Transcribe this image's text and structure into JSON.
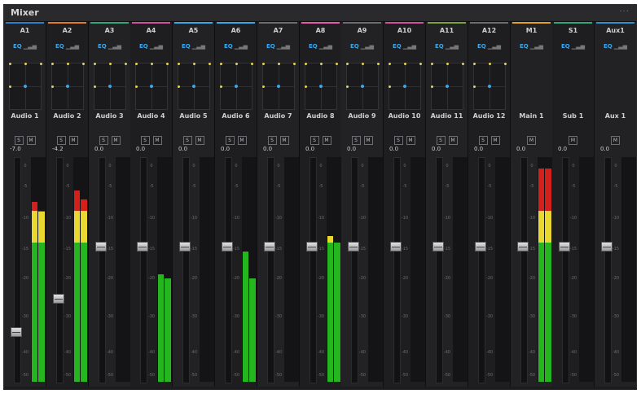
{
  "window": {
    "title": "Mixer",
    "menu": "···"
  },
  "colors": {
    "eq": "#3aa6e8",
    "green": "#24b51f",
    "yellow": "#e8d830",
    "red": "#d4201b"
  },
  "strips": [
    {
      "track": "A1",
      "name": "Audio 1",
      "db": "-7.0",
      "color": "#2b7fd0",
      "solo": true,
      "pan": true,
      "level": 0.78,
      "meters": [
        0.8,
        0.76
      ]
    },
    {
      "track": "A2",
      "name": "Audio 2",
      "db": "-4.2",
      "color": "#e07a2a",
      "solo": true,
      "pan": true,
      "level": 0.63,
      "meters": [
        0.85,
        0.81
      ]
    },
    {
      "track": "A3",
      "name": "Audio 3",
      "db": "0.0",
      "color": "#2fa67a",
      "solo": true,
      "pan": true,
      "level": 0.4,
      "meters": [
        0,
        0
      ]
    },
    {
      "track": "A4",
      "name": "Audio 4",
      "db": "0.0",
      "color": "#d14fa0",
      "solo": true,
      "pan": true,
      "level": 0.4,
      "meters": [
        0.48,
        0.46
      ]
    },
    {
      "track": "A5",
      "name": "Audio 5",
      "db": "0.0",
      "color": "#3aa6e8",
      "solo": true,
      "pan": true,
      "level": 0.4,
      "meters": [
        0,
        0
      ]
    },
    {
      "track": "A6",
      "name": "Audio 6",
      "db": "0.0",
      "color": "#3aa6e8",
      "solo": true,
      "pan": true,
      "level": 0.4,
      "meters": [
        0.58,
        0.46
      ]
    },
    {
      "track": "A7",
      "name": "Audio 7",
      "db": "0.0",
      "color": "#6b6b70",
      "solo": true,
      "pan": true,
      "level": 0.4,
      "meters": [
        0,
        0
      ]
    },
    {
      "track": "A8",
      "name": "Audio 8",
      "db": "0.0",
      "color": "#e35aa8",
      "solo": true,
      "pan": true,
      "level": 0.4,
      "meters": [
        0.65,
        0.62
      ]
    },
    {
      "track": "A9",
      "name": "Audio 9",
      "db": "0.0",
      "color": "#6b6b70",
      "solo": true,
      "pan": true,
      "level": 0.4,
      "meters": [
        0,
        0
      ]
    },
    {
      "track": "A10",
      "name": "Audio 10",
      "db": "0.0",
      "color": "#d14fa0",
      "solo": true,
      "pan": true,
      "level": 0.4,
      "meters": [
        0,
        0
      ]
    },
    {
      "track": "A11",
      "name": "Audio 11",
      "db": "0.0",
      "color": "#7aa33a",
      "solo": true,
      "pan": true,
      "level": 0.4,
      "meters": [
        0,
        0
      ]
    },
    {
      "track": "A12",
      "name": "Audio 12",
      "db": "0.0",
      "color": "#6b6b70",
      "solo": true,
      "pan": true,
      "level": 0.4,
      "meters": [
        0,
        0
      ]
    },
    {
      "track": "M1",
      "name": "Main 1",
      "db": "0.0",
      "color": "#e0a020",
      "solo": false,
      "pan": false,
      "level": 0.4,
      "meters": [
        0.95,
        0.95
      ]
    },
    {
      "track": "S1",
      "name": "Sub 1",
      "db": "0.0",
      "color": "#2fa67a",
      "solo": false,
      "pan": false,
      "level": 0.4,
      "meters": [
        0,
        0
      ]
    },
    {
      "track": "Aux1",
      "name": "Aux 1",
      "db": "0.0",
      "color": "#2f8fd0",
      "solo": false,
      "pan": false,
      "level": 0.4,
      "meters": [
        0,
        0
      ]
    }
  ],
  "eq_label": "EQ",
  "solo_label": "S",
  "mute_label": "M",
  "scale_ticks": [
    "0",
    "-5",
    "-10",
    "-15",
    "-20",
    "-30",
    "-40",
    "-50"
  ]
}
